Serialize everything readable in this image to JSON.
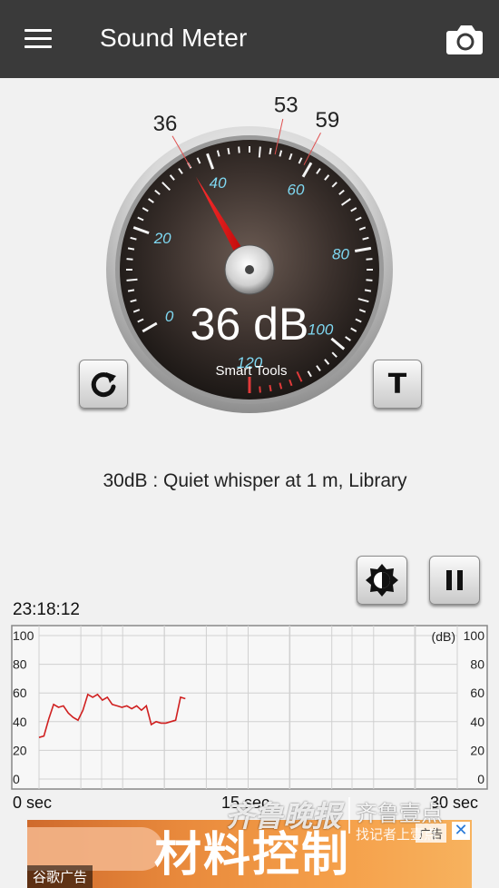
{
  "app": {
    "title": "Sound Meter",
    "icons": {
      "menu": "hamburger-menu-icon",
      "camera": "camera-icon"
    }
  },
  "meter": {
    "value": 36,
    "reading": "36 dB",
    "brand": "Smart Tools",
    "scale_labels": [
      "0",
      "20",
      "40",
      "60",
      "80",
      "100",
      "120"
    ],
    "scale_min": 0,
    "scale_max": 120,
    "markers": [
      {
        "label": "36",
        "value": 36
      },
      {
        "label": "53",
        "value": 53
      },
      {
        "label": "59",
        "value": 59
      }
    ],
    "colors": {
      "scale_text": "#7fd8f2",
      "needle": "#e00000",
      "danger_ticks": "#e23a3a"
    },
    "buttons": {
      "reset_icon": "refresh-icon",
      "t_label": "T"
    }
  },
  "description": "30dB : Quiet whisper at 1 m, Library",
  "controls": {
    "brightness_icon": "brightness-icon",
    "pause_icon": "pause-icon"
  },
  "history": {
    "time": "23:18:12",
    "unit": "(dB)",
    "y_ticks": [
      "100",
      "80",
      "60",
      "40",
      "20",
      "0"
    ],
    "x_labels": [
      "0 sec",
      "15 sec",
      "30 sec"
    ]
  },
  "chart_data": {
    "type": "line",
    "title": "",
    "xlabel": "",
    "ylabel": "(dB)",
    "xlim": [
      0,
      30
    ],
    "ylim": [
      0,
      100
    ],
    "grid": true,
    "series": [
      {
        "color": "#d02020",
        "x": [
          0,
          0.35,
          0.7,
          1.05,
          1.4,
          1.75,
          2.1,
          2.45,
          2.8,
          3.15,
          3.5,
          3.85,
          4.2,
          4.55,
          4.9,
          5.25,
          5.6,
          5.95,
          6.3,
          6.65,
          7.0,
          7.35,
          7.7,
          8.05,
          8.4,
          8.75,
          9.1,
          9.45,
          9.8,
          10.15,
          10.5
        ],
        "y": [
          29,
          30,
          42,
          52,
          50,
          51,
          46,
          43,
          41,
          48,
          59,
          57,
          59,
          55,
          57,
          52,
          51,
          50,
          51,
          49,
          51,
          48,
          51,
          38,
          40,
          39,
          39,
          40,
          41,
          57,
          56
        ]
      }
    ]
  },
  "ad": {
    "headline": "材料控制",
    "label": "谷歌广告",
    "badge": "广告",
    "close": "✕",
    "watermark_left": "齐鲁晚报",
    "watermark_right": "齐鲁壹点",
    "watermark_sub": "找记者上壹点"
  }
}
